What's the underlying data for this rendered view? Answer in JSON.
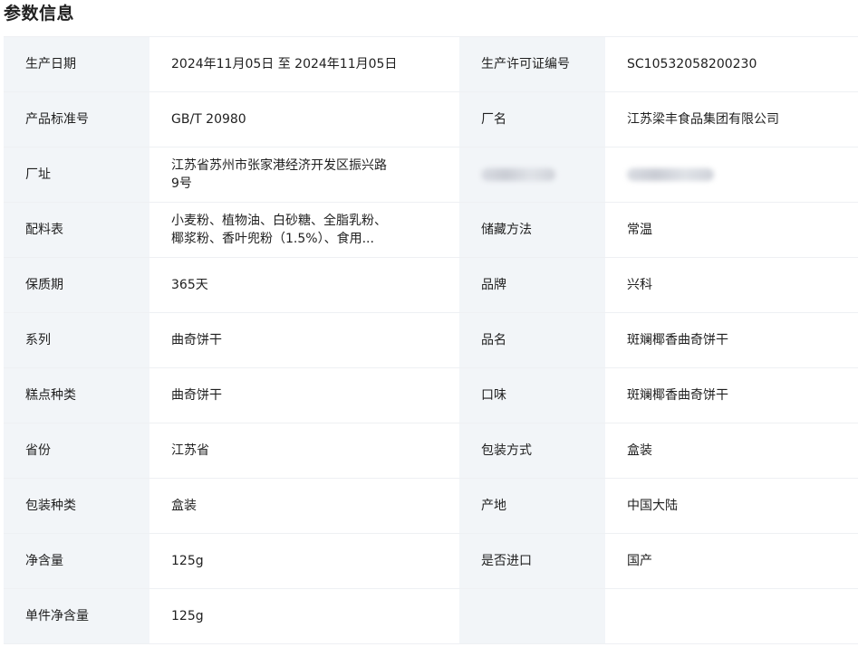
{
  "title": "参数信息",
  "rows": [
    [
      {
        "label": "生产日期",
        "value": "2024年11月05日 至 2024年11月05日"
      },
      {
        "label": "生产许可证编号",
        "value": "SC10532058200230"
      }
    ],
    [
      {
        "label": "产品标准号",
        "value": "GB/T 20980"
      },
      {
        "label": "厂名",
        "value": "江苏梁丰食品集团有限公司"
      }
    ],
    [
      {
        "label": "厂址",
        "value": "江苏省苏州市张家港经济开发区振兴路9号"
      },
      {
        "label": "",
        "value": ""
      }
    ],
    [
      {
        "label": "配料表",
        "value": "小麦粉、植物油、白砂糖、全脂乳粉、椰浆粉、香叶兜粉（1.5%）、食用..."
      },
      {
        "label": "储藏方法",
        "value": "常温"
      }
    ],
    [
      {
        "label": "保质期",
        "value": "365天"
      },
      {
        "label": "品牌",
        "value": "兴科"
      }
    ],
    [
      {
        "label": "系列",
        "value": "曲奇饼干"
      },
      {
        "label": "品名",
        "value": "斑斓椰香曲奇饼干"
      }
    ],
    [
      {
        "label": "糕点种类",
        "value": "曲奇饼干"
      },
      {
        "label": "口味",
        "value": "斑斓椰香曲奇饼干"
      }
    ],
    [
      {
        "label": "省份",
        "value": "江苏省"
      },
      {
        "label": "包装方式",
        "value": "盒装"
      }
    ],
    [
      {
        "label": "包装种类",
        "value": "盒装"
      },
      {
        "label": "产地",
        "value": "中国大陆"
      }
    ],
    [
      {
        "label": "净含量",
        "value": "125g"
      },
      {
        "label": "是否进口",
        "value": "国产"
      }
    ],
    [
      {
        "label": "单件净含量",
        "value": "125g"
      },
      {
        "label": "",
        "value": ""
      }
    ]
  ]
}
